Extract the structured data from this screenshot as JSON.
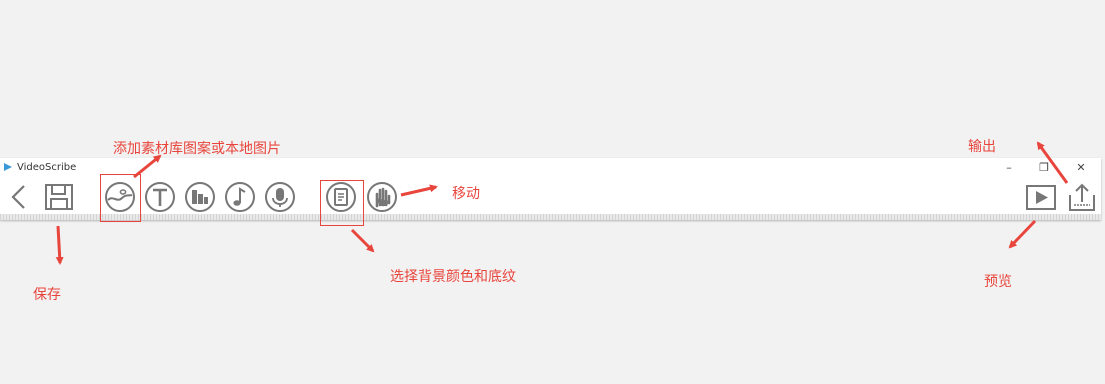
{
  "window": {
    "title": "VideoScribe",
    "minimize_glyph": "–",
    "restore_glyph": "❐",
    "close_glyph": "✕"
  },
  "toolbar": {
    "left": [
      {
        "name": "back-icon"
      },
      {
        "name": "save-icon"
      }
    ],
    "insert": [
      {
        "name": "image-icon"
      },
      {
        "name": "text-icon"
      },
      {
        "name": "chart-icon"
      },
      {
        "name": "music-note-icon"
      },
      {
        "name": "microphone-icon"
      }
    ],
    "background": {
      "name": "background-icon"
    },
    "hand": {
      "name": "hand-icon"
    },
    "right": [
      {
        "name": "play-icon"
      },
      {
        "name": "export-icon"
      }
    ]
  },
  "annotations": {
    "add_image": "添加素材库图案或本地图片",
    "move": "移动",
    "save": "保存",
    "background": "选择背景颜色和底纹",
    "export": "输出",
    "preview": "预览"
  },
  "colors": {
    "annotation": "#e8453c",
    "icon": "#777777",
    "logo": "#3a9ad9"
  }
}
